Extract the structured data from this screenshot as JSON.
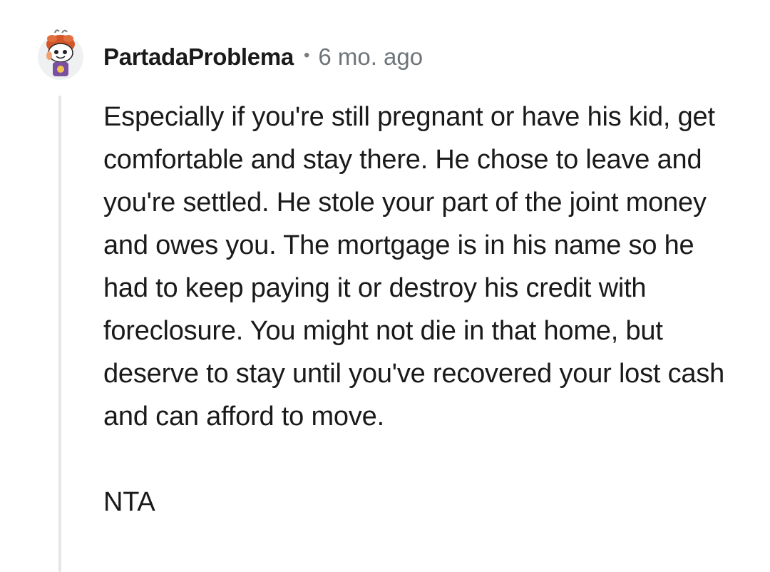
{
  "comment": {
    "username": "PartadaProblema",
    "separator": "•",
    "timestamp": "6 mo. ago",
    "paragraphs": [
      "Especially if you're still pregnant or have his kid, get comfortable and stay there. He chose to leave and you're settled. He stole your part of the joint money and owes you. The mortgage is in his name so he had to keep paying it or destroy his credit with foreclosure. You might not die in that home, but deserve to stay until you've recovered your lost cash and can afford to move.",
      "NTA"
    ]
  },
  "colors": {
    "background": "#ffffff",
    "text": "#1a1a1b",
    "meta": "#6f7478",
    "thread_line": "#e6e6e6",
    "avatar_hair": "#d2562a",
    "avatar_shirt": "#7b4fa0"
  }
}
